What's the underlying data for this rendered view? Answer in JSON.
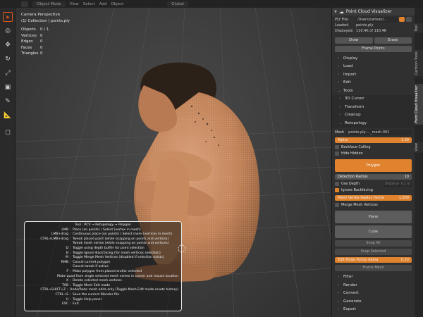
{
  "header": {
    "mode": "Object Mode",
    "menus": [
      "View",
      "Select",
      "Add",
      "Object"
    ],
    "orientation": "Global"
  },
  "viewport": {
    "title": "Camera Perspective",
    "collection": "(1) Collection | points.ply",
    "stats": [
      {
        "label": "Objects",
        "value": "0 / 1"
      },
      {
        "label": "Vertices",
        "value": "0"
      },
      {
        "label": "Edges",
        "value": "0"
      },
      {
        "label": "Faces",
        "value": "0"
      },
      {
        "label": "Triangles",
        "value": "0"
      }
    ]
  },
  "help": [
    {
      "k": "",
      "d": "Tool : PCV → Retopology → Polygon",
      "title": true
    },
    {
      "k": "LMB :",
      "d": "Place (on points) / Select (vertex in mesh)"
    },
    {
      "k": "LMB+drag :",
      "d": "Continuous place (on points) / Select more (vertices in mesh)"
    },
    {
      "k": "CTRL+LMB+drag :",
      "d": "Tweak placed point (while snapping on points and vertices)"
    },
    {
      "k": "",
      "d": "Tweak mesh vertex (while snapping on points and vertices)"
    },
    {
      "k": "D :",
      "d": "Toggle using depth buffer for point selection"
    },
    {
      "k": "B :",
      "d": "Toggle Ignore Backfacing (for mesh vertices selection)"
    },
    {
      "k": "M :",
      "d": "Toggle Merge Mesh Vertices (disabled if selection exists)"
    },
    {
      "k": "RMB :",
      "d": "Cancel current polygon"
    },
    {
      "k": "",
      "d": "Cancel tweak if active"
    },
    {
      "k": "F :",
      "d": "Make polygon from placed and/or selected"
    },
    {
      "k": "",
      "d": "Make quad from single selected mesh vertex in corner and mouse location"
    },
    {
      "k": "X :",
      "d": "Delete selected mesh vertices"
    },
    {
      "k": "TAB :",
      "d": "Toggle Mesh Edit mode"
    },
    {
      "k": "CTRL+SHIFT+Z :",
      "d": "Undo/Redo mesh edits only (Toggle Mesh Edit mode resets history)"
    },
    {
      "k": "CTRL+S :",
      "d": "Save the current Blender file"
    },
    {
      "k": "H :",
      "d": "Toggle Help panel"
    },
    {
      "k": "ESC :",
      "d": "Exit"
    }
  ],
  "panel": {
    "title": "Point Cloud Visualizer",
    "ply_file_label": "PLY File:",
    "ply_file_value": "/Users/carlson/...",
    "loaded_label": "Loaded:",
    "loaded_value": "points.ply",
    "displayed_label": "Displayed:",
    "displayed_value": "110.4K of 110.4K",
    "draw": "Draw",
    "erase": "Erase",
    "frame_points": "Frame Points",
    "sections_top": [
      "Display",
      "Load",
      "Import",
      "Edit",
      "Tools"
    ],
    "tools_subs": [
      "3D Cursor",
      "Transform",
      "Cleanup",
      "Retopology"
    ],
    "mesh_label": "Mesh",
    "mesh_value": "points.ply-..._mesh.001",
    "alpha_label": "Alpha",
    "alpha_value": "1.00",
    "backface_culling": "Backface Culling",
    "hide_hidden": "Hide Hidden",
    "polygon": "Polygon",
    "detection_radius_label": "Detection Radius",
    "detection_radius_value": "10",
    "use_depth": "Use Depth",
    "distance_label": "Distance",
    "distance_value": "0.1 m",
    "ignore_backfacing": "Ignore Backfacing",
    "merge_radius_label": "Mesh Vertex Radius Factor",
    "merge_radius_value": "1.500",
    "merge_mesh_vertices": "Merge Mesh Vertices",
    "plane": "Plane",
    "cube": "Cube",
    "snap_all": "Snap All",
    "snap_selected": "Snap Selected",
    "edit_alpha_label": "Edit Mode Points Alpha",
    "edit_alpha_value": "0.10",
    "frame_mesh": "Frame Mesh",
    "sections_bottom": [
      "Filter",
      "Render",
      "Convert",
      "Generate",
      "Export"
    ]
  },
  "vtabs": [
    "Tool",
    "Cartoon Tools",
    "Point Cloud Visualizer",
    "View"
  ],
  "colors": {
    "accent": "#e0822e",
    "skin": "#c98d5f",
    "bg": "#3c3c3c"
  }
}
